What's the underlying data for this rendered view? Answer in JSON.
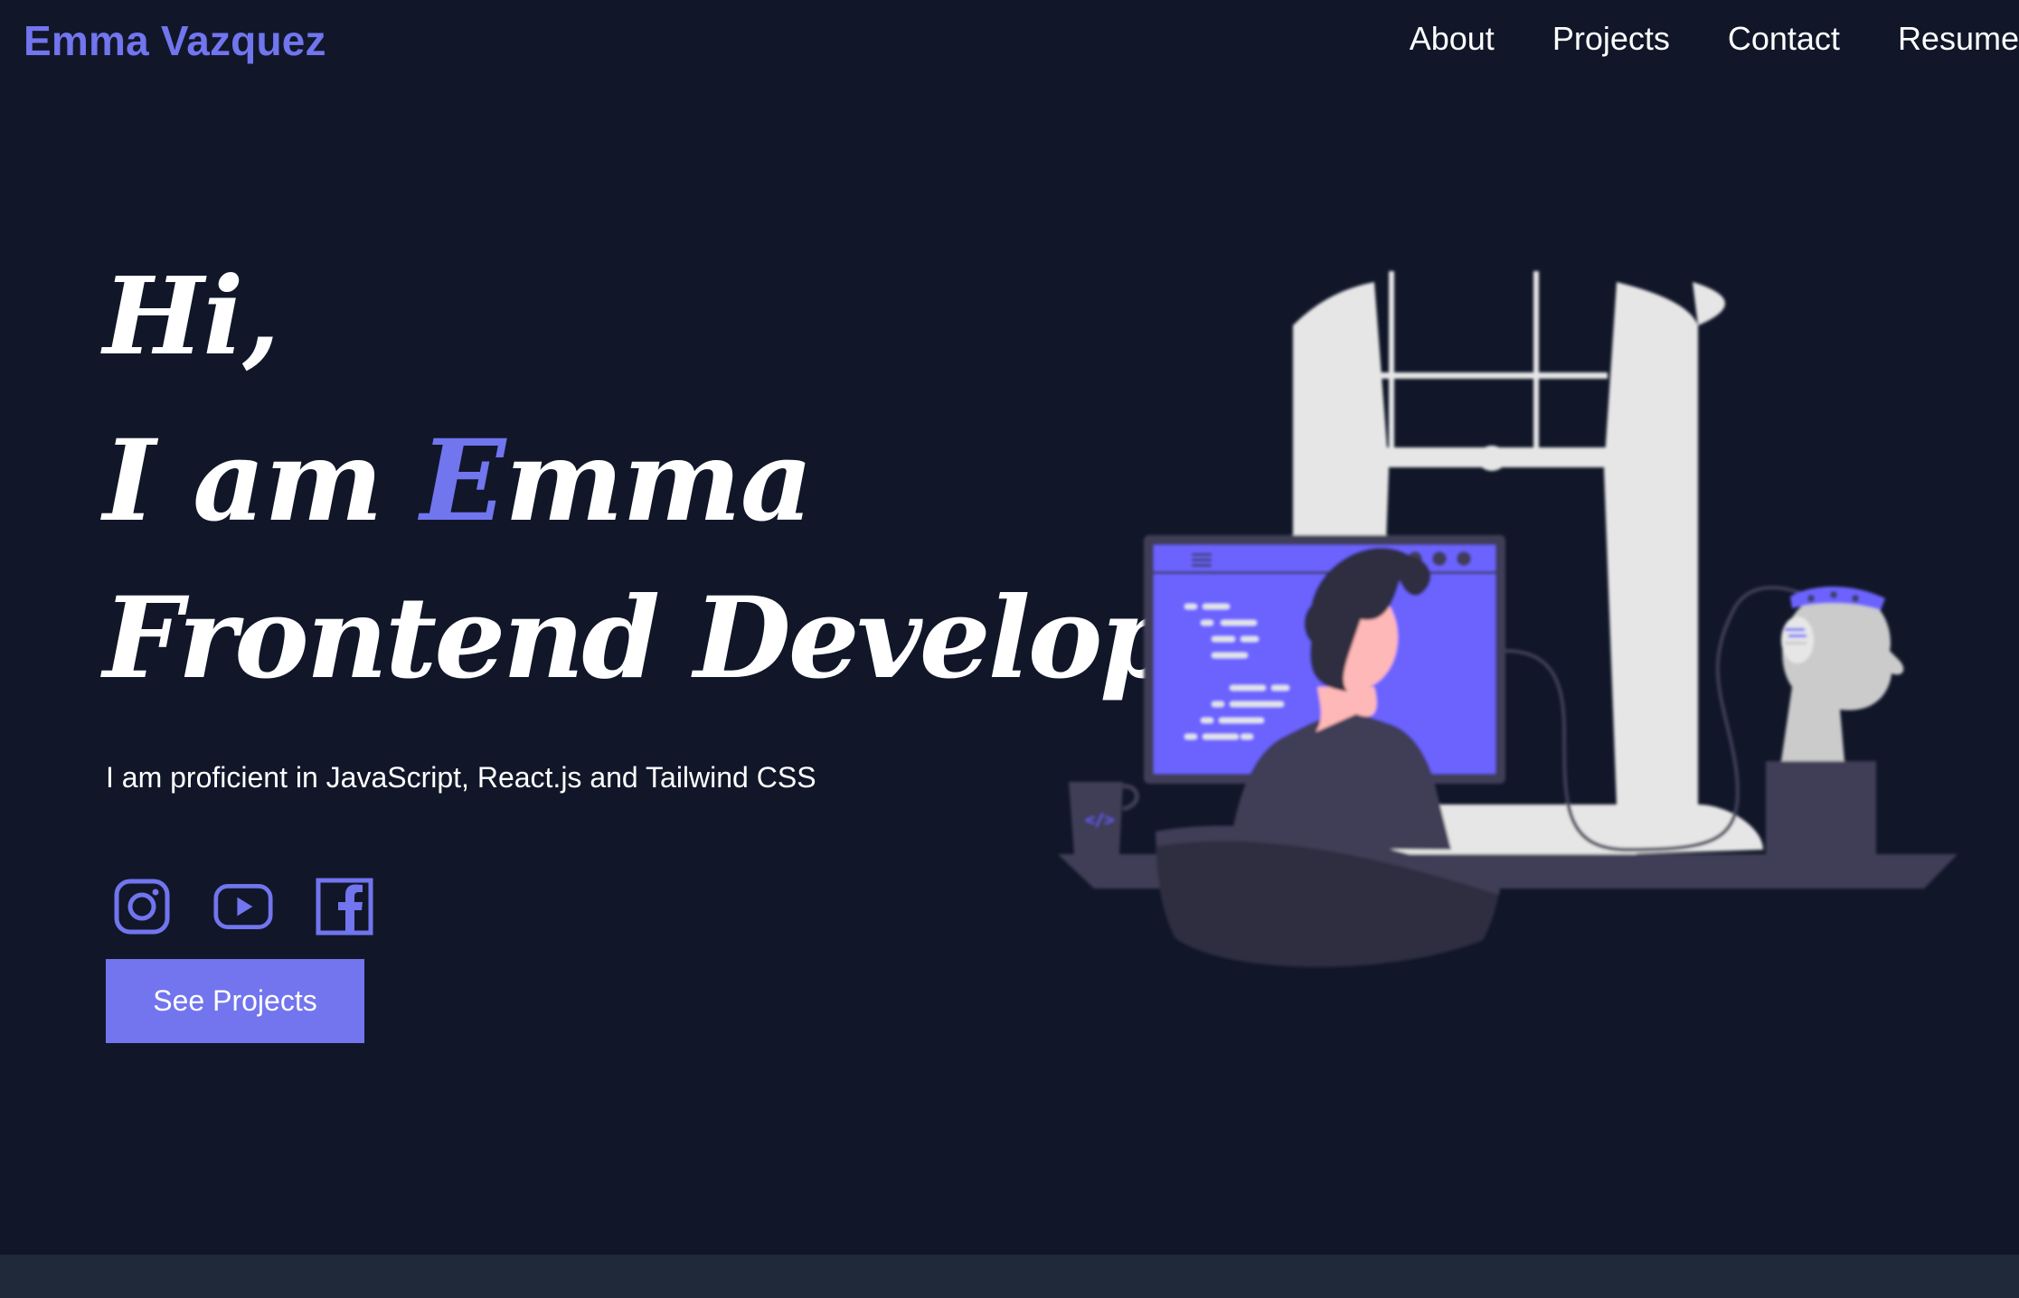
{
  "header": {
    "brand": "Emma Vazquez",
    "nav": [
      {
        "label": "About"
      },
      {
        "label": "Projects"
      },
      {
        "label": "Contact"
      },
      {
        "label": "Resume"
      }
    ]
  },
  "hero": {
    "greeting": "Hi,",
    "intro_prefix": "I am ",
    "name_initial": "E",
    "name_rest": "mma",
    "role": "Frontend Developer",
    "tagline": "I am proficient in JavaScript, React.js and Tailwind CSS",
    "cta_label": "See Projects"
  },
  "socials": [
    {
      "icon": "instagram-icon"
    },
    {
      "icon": "youtube-icon"
    },
    {
      "icon": "facebook-icon"
    }
  ],
  "colors": {
    "background": "#111729",
    "accent": "#7175ee",
    "text": "#ffffff",
    "footer": "#1f2939"
  }
}
